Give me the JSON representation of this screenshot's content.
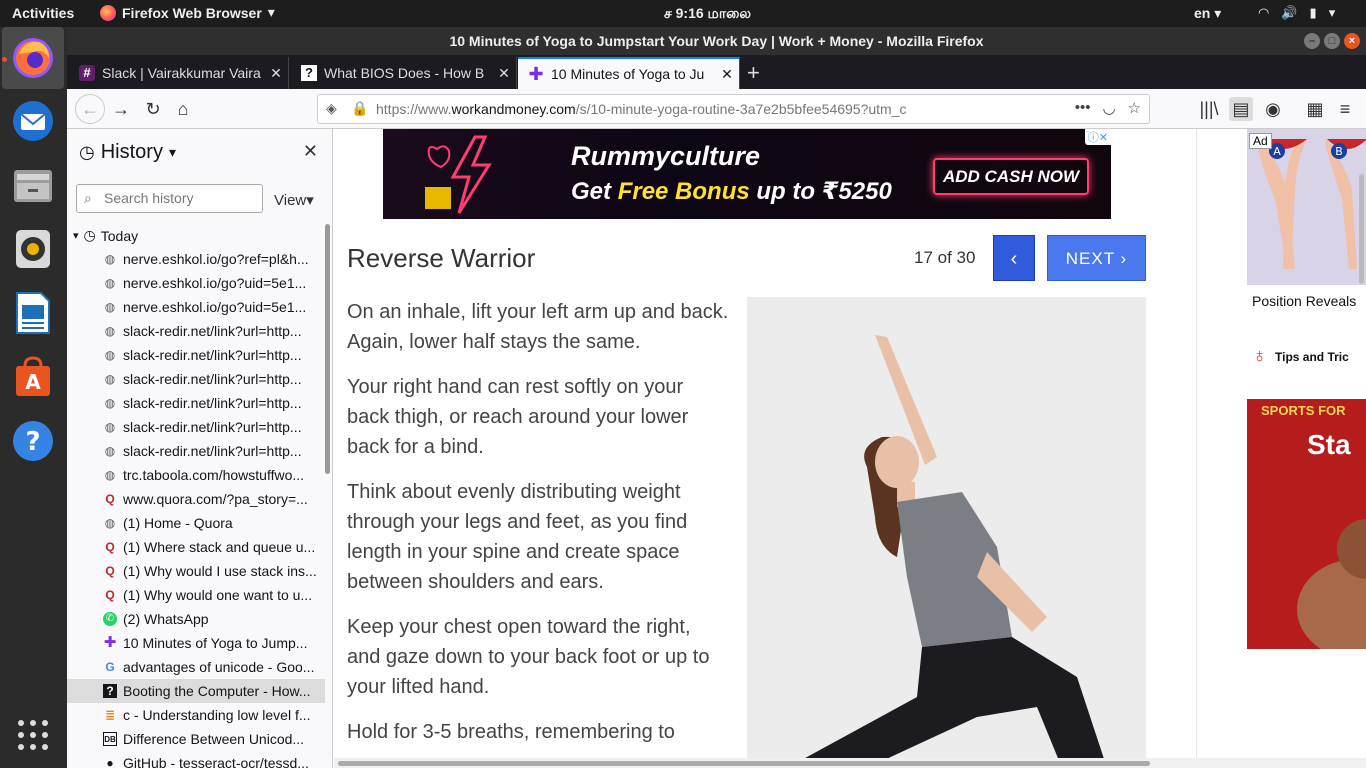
{
  "topbar": {
    "activities": "Activities",
    "app_name": "Firefox Web Browser",
    "clock": "ச  9:16 மாலை",
    "lang": "en"
  },
  "window": {
    "title": "10 Minutes of Yoga to Jumpstart Your Work Day | Work + Money - Mozilla Firefox"
  },
  "tabs": [
    {
      "label": "Slack | Vairakkumar Vaira",
      "favicon": "slack-icon"
    },
    {
      "label": "What BIOS Does - How B",
      "favicon": "howstuffworks-icon"
    },
    {
      "label": "10 Minutes of Yoga to Ju",
      "favicon": "workandmoney-icon"
    }
  ],
  "url": {
    "prefix": "https://www.",
    "host": "workandmoney.com",
    "path": "/s/10-minute-yoga-routine-3a7e2b5bfee54695?utm_c"
  },
  "sidebar": {
    "title": "History",
    "search_placeholder": "Search history",
    "view_label": "View",
    "group_label": "Today",
    "items": [
      {
        "label": "nerve.eshkol.io/go?ref=pl&h...",
        "icon": "globe-icon"
      },
      {
        "label": "nerve.eshkol.io/go?uid=5e1...",
        "icon": "globe-icon"
      },
      {
        "label": "nerve.eshkol.io/go?uid=5e1...",
        "icon": "globe-icon"
      },
      {
        "label": "slack-redir.net/link?url=http...",
        "icon": "globe-icon"
      },
      {
        "label": "slack-redir.net/link?url=http...",
        "icon": "globe-icon"
      },
      {
        "label": "slack-redir.net/link?url=http...",
        "icon": "globe-icon"
      },
      {
        "label": "slack-redir.net/link?url=http...",
        "icon": "globe-icon"
      },
      {
        "label": "slack-redir.net/link?url=http...",
        "icon": "globe-icon"
      },
      {
        "label": "slack-redir.net/link?url=http...",
        "icon": "globe-icon"
      },
      {
        "label": "trc.taboola.com/howstuffwo...",
        "icon": "globe-icon"
      },
      {
        "label": "www.quora.com/?pa_story=...",
        "icon": "quora-icon"
      },
      {
        "label": "(1) Home - Quora",
        "icon": "globe-icon"
      },
      {
        "label": "(1) Where stack and queue u...",
        "icon": "quora-icon"
      },
      {
        "label": "(1) Why would I use stack ins...",
        "icon": "quora-icon"
      },
      {
        "label": "(1) Why would one want to u...",
        "icon": "quora-icon"
      },
      {
        "label": "(2) WhatsApp",
        "icon": "whatsapp-icon"
      },
      {
        "label": "10 Minutes of Yoga to Jump...",
        "icon": "workandmoney-icon"
      },
      {
        "label": "advantages of unicode - Goo...",
        "icon": "google-icon"
      },
      {
        "label": "Booting the Computer - How...",
        "icon": "howstuffworks-icon",
        "selected": true
      },
      {
        "label": "c - Understanding low level f...",
        "icon": "stackoverflow-icon"
      },
      {
        "label": "Difference Between Unicod...",
        "icon": "db-icon"
      },
      {
        "label": "GitHub - tesseract-ocr/tessd...",
        "icon": "github-icon"
      }
    ]
  },
  "ad_banner": {
    "brand": "Rummyculture",
    "offer_prefix": "Get ",
    "offer_highlight": "Free Bonus",
    "offer_suffix": " up to ₹5250",
    "cta": "ADD CASH NOW"
  },
  "slide": {
    "title": "Reverse Warrior",
    "count": "17 of 30",
    "prev": "‹",
    "next": "NEXT  ›",
    "paragraphs": [
      "On an inhale, lift your left arm up and back. Again, lower half stays the same.",
      "Your right hand can rest softly on your back thigh, or reach around your lower back for a bind.",
      "Think about evenly distributing weight through your legs and feet, as you find length in your spine and create space between shoulders and ears.",
      "Keep your chest open toward the right, and gaze down to your back foot or up to your lifted hand.",
      "Hold for 3-5 breaths, remembering to"
    ]
  },
  "right_col": {
    "ad_label": "Ad",
    "ad_caption": "Position Reveals",
    "tip_label": "Tips and Tric",
    "ad2_line1": "SPORTS FOR",
    "ad2_line2": "Sta"
  },
  "colors": {
    "accent": "#0a84ff",
    "prev_button": "#2f5bdc",
    "next_button": "#4c78ef",
    "ubuntu_orange": "#e95420"
  }
}
